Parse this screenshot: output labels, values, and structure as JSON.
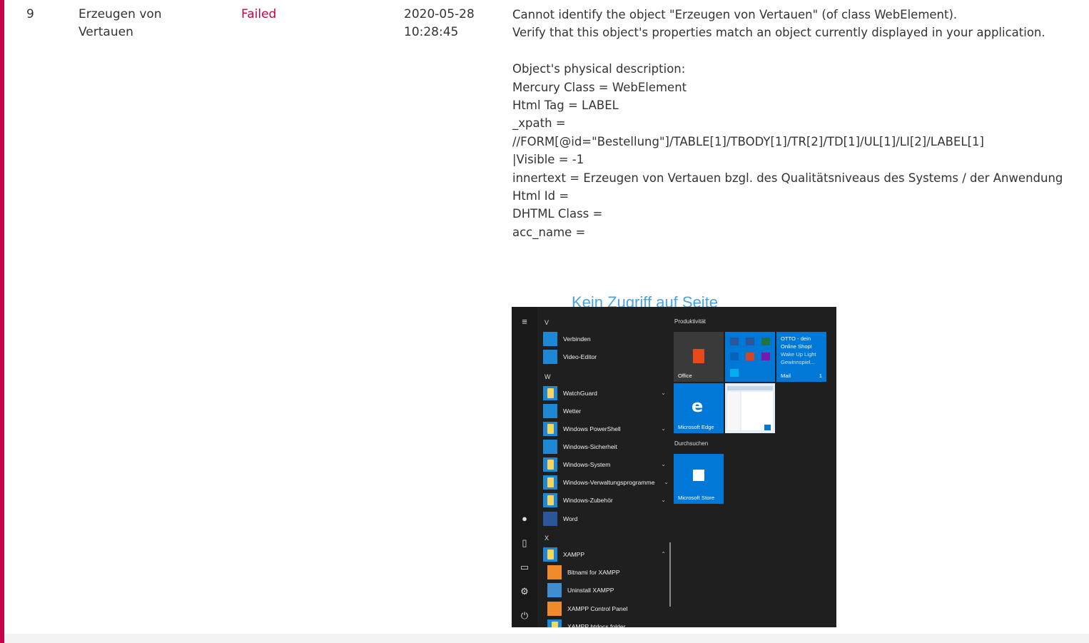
{
  "row": {
    "number": "9",
    "name_line1": "Erzeugen von",
    "name_line2": "Vertauen",
    "status": "Failed",
    "date": "2020-05-28",
    "time": "10:28:45",
    "message_lines": [
      "Cannot identify the object \"Erzeugen von Vertauen\" (of class WebElement).",
      "Verify that this object's properties match an object currently displayed in your application.",
      "",
      "Object's physical description:",
      "Mercury Class = WebElement",
      "Html Tag = LABEL",
      "_xpath =",
      "//FORM[@id=\"Bestellung\"]/TABLE[1]/TBODY[1]/TR[2]/TD[1]/UL[1]/LI[2]/LABEL[1]",
      "|Visible = -1",
      "innertext = Erzeugen von Vertauen bzgl. des Qualitätsniveaus des Systems / der Anwendung",
      "Html Id =",
      "DHTML Class =",
      "acc_name ="
    ]
  },
  "screenshot": {
    "page_heading": "Kein Zugriff auf Seite",
    "letters": {
      "v": "V",
      "w": "W",
      "x": "X"
    },
    "apps": {
      "verbinden": "Verbinden",
      "video_editor": "Video-Editor",
      "watchguard": "WatchGuard",
      "wetter": "Wetter",
      "powershell": "Windows PowerShell",
      "sicherheit": "Windows-Sicherheit",
      "system": "Windows-System",
      "verwaltung": "Windows-Verwaltungsprogramme",
      "zubehoer": "Windows-Zubehör",
      "word": "Word",
      "xampp": "XAMPP",
      "bitnami": "Bitnami for XAMPP",
      "uninstall": "Uninstall XAMPP",
      "control_panel": "XAMPP Control Panel",
      "htdocs": "XAMPP htdocs folder"
    },
    "groups": {
      "produktivitaet": "Produktivität",
      "durchsuchen": "Durchsuchen"
    },
    "tiles": {
      "office": "Office",
      "otto_line1": "OTTO - dein",
      "otto_line2": "Online Shop!",
      "otto_line3": "Wake Up Light",
      "otto_line4": "Gewinnspiel...",
      "mail": "Mail",
      "mail_count": "1",
      "edge": "Microsoft Edge",
      "store": "Microsoft Store"
    },
    "colors": {
      "accent": "#0078d7",
      "start_bg": "#1f1f1f",
      "failed": "#c8004b"
    }
  }
}
